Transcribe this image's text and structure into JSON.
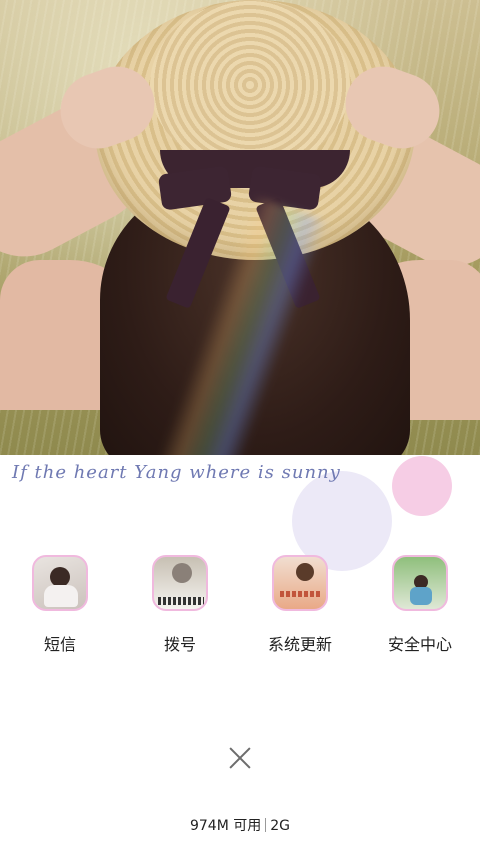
{
  "header": {
    "quote": "If the heart Yang where is sunny"
  },
  "apps": [
    {
      "label": "短信",
      "icon": "sms-icon"
    },
    {
      "label": "拨号",
      "icon": "dialer-icon"
    },
    {
      "label": "系统更新",
      "icon": "system-update-icon"
    },
    {
      "label": "安全中心",
      "icon": "security-center-icon"
    }
  ],
  "footer": {
    "memory": "974M 可用",
    "total": "2G"
  },
  "colors": {
    "quote_text": "#6f79b2",
    "icon_border": "#f0b9de",
    "bubble_pink": "#f6cde5",
    "bubble_lilac": "#ece9f7"
  }
}
